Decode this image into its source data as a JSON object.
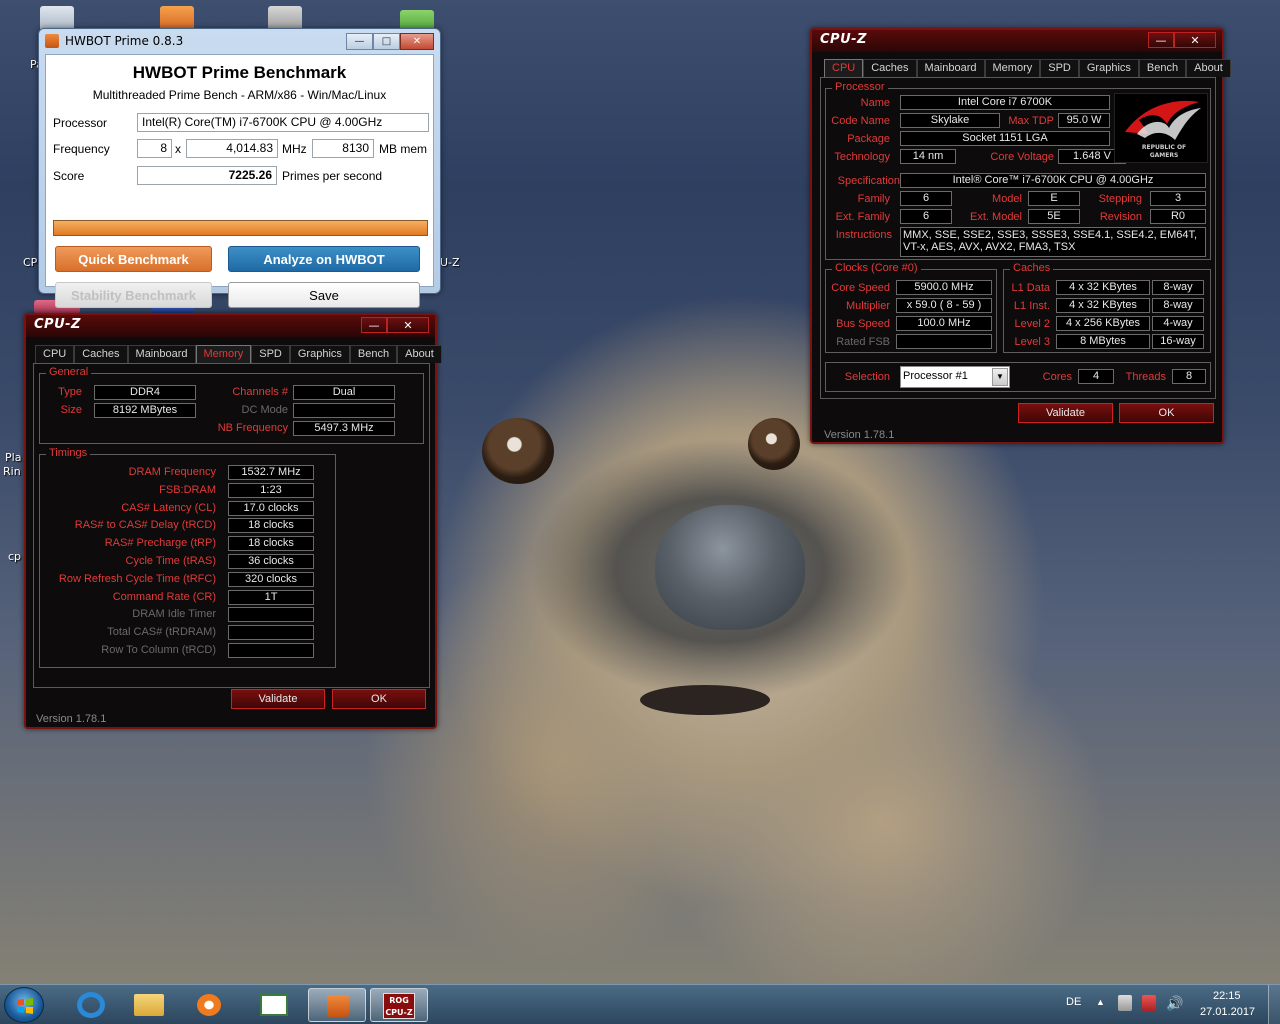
{
  "desktop": {
    "icon_labels": [
      "Pa",
      "CP",
      "Pla",
      "Rin",
      "cp",
      "U-Z"
    ]
  },
  "hwbot": {
    "window_title": "HWBOT Prime 0.8.3",
    "heading": "HWBOT Prime Benchmark",
    "subheading": "Multithreaded Prime Bench - ARM/x86 - Win/Mac/Linux",
    "processor_label": "Processor",
    "processor_value": "Intel(R) Core(TM) i7-6700K CPU @ 4.00GHz",
    "frequency_label": "Frequency",
    "multiplier": "8",
    "times": "x",
    "frequency_value": "4,014.83",
    "mhz_unit": "MHz",
    "mem_value": "8130",
    "mem_unit": "MB mem",
    "score_label": "Score",
    "score_value": "7225.26",
    "score_unit": "Primes per second",
    "progress": 1.0,
    "buttons": {
      "quick": "Quick Benchmark",
      "analyze": "Analyze on HWBOT",
      "stability": "Stability Benchmark",
      "save": "Save"
    }
  },
  "cpuz_memory": {
    "title": "CPU-Z",
    "tabs": [
      "CPU",
      "Caches",
      "Mainboard",
      "Memory",
      "SPD",
      "Graphics",
      "Bench",
      "About"
    ],
    "active_tab": "Memory",
    "general": {
      "group_title": "General",
      "type_label": "Type",
      "type_value": "DDR4",
      "size_label": "Size",
      "size_value": "8192 MBytes",
      "channels_label": "Channels #",
      "channels_value": "Dual",
      "dcmode_label": "DC Mode",
      "dcmode_value": "",
      "nbfreq_label": "NB Frequency",
      "nbfreq_value": "5497.3 MHz"
    },
    "timings": {
      "group_title": "Timings",
      "rows": [
        {
          "label": "DRAM Frequency",
          "value": "1532.7 MHz"
        },
        {
          "label": "FSB:DRAM",
          "value": "1:23"
        },
        {
          "label": "CAS# Latency (CL)",
          "value": "17.0 clocks"
        },
        {
          "label": "RAS# to CAS# Delay (tRCD)",
          "value": "18 clocks"
        },
        {
          "label": "RAS# Precharge (tRP)",
          "value": "18 clocks"
        },
        {
          "label": "Cycle Time (tRAS)",
          "value": "36 clocks"
        },
        {
          "label": "Row Refresh Cycle Time (tRFC)",
          "value": "320 clocks"
        },
        {
          "label": "Command Rate (CR)",
          "value": "1T"
        },
        {
          "label": "DRAM Idle Timer",
          "value": ""
        },
        {
          "label": "Total CAS# (tRDRAM)",
          "value": ""
        },
        {
          "label": "Row To Column (tRCD)",
          "value": ""
        }
      ]
    },
    "validate": "Validate",
    "ok": "OK",
    "version": "Version 1.78.1"
  },
  "cpuz_cpu": {
    "title": "CPU-Z",
    "tabs": [
      "CPU",
      "Caches",
      "Mainboard",
      "Memory",
      "SPD",
      "Graphics",
      "Bench",
      "About"
    ],
    "active_tab": "CPU",
    "processor_group": "Processor",
    "name_label": "Name",
    "name_value": "Intel Core i7 6700K",
    "codename_label": "Code Name",
    "codename_value": "Skylake",
    "maxtdp_label": "Max TDP",
    "maxtdp_value": "95.0 W",
    "package_label": "Package",
    "package_value": "Socket 1151 LGA",
    "technology_label": "Technology",
    "technology_value": "14 nm",
    "corevoltage_label": "Core Voltage",
    "corevoltage_value": "1.648 V",
    "spec_label": "Specification",
    "spec_value": "Intel® Core™ i7-6700K CPU @ 4.00GHz",
    "family_label": "Family",
    "family_value": "6",
    "model_label": "Model",
    "model_value": "E",
    "stepping_label": "Stepping",
    "stepping_value": "3",
    "extfamily_label": "Ext. Family",
    "extfamily_value": "6",
    "extmodel_label": "Ext. Model",
    "extmodel_value": "5E",
    "revision_label": "Revision",
    "revision_value": "R0",
    "instructions_label": "Instructions",
    "instructions_value": "MMX, SSE, SSE2, SSE3, SSSE3, SSE4.1, SSE4.2, EM64T, VT-x, AES, AVX, AVX2, FMA3, TSX",
    "rog_text": "REPUBLIC OF GAMERS",
    "clocks_group": "Clocks (Core #0)",
    "corespeed_label": "Core Speed",
    "corespeed_value": "5900.0 MHz",
    "multiplier_label": "Multiplier",
    "multiplier_value": "x 59.0 ( 8 - 59 )",
    "busspeed_label": "Bus Speed",
    "busspeed_value": "100.0 MHz",
    "ratedfsb_label": "Rated FSB",
    "ratedfsb_value": "",
    "caches_group": "Caches",
    "caches": [
      {
        "label": "L1 Data",
        "size": "4 x 32 KBytes",
        "assoc": "8-way"
      },
      {
        "label": "L1 Inst.",
        "size": "4 x 32 KBytes",
        "assoc": "8-way"
      },
      {
        "label": "Level 2",
        "size": "4 x 256 KBytes",
        "assoc": "4-way"
      },
      {
        "label": "Level 3",
        "size": "8 MBytes",
        "assoc": "16-way"
      }
    ],
    "selection_label": "Selection",
    "selection_value": "Processor #1",
    "cores_label": "Cores",
    "cores_value": "4",
    "threads_label": "Threads",
    "threads_value": "8",
    "validate": "Validate",
    "ok": "OK",
    "version": "Version 1.78.1"
  },
  "taskbar": {
    "language": "DE",
    "time": "22:15",
    "date": "27.01.2017",
    "cpuz_label": "ROG CPU-Z"
  }
}
